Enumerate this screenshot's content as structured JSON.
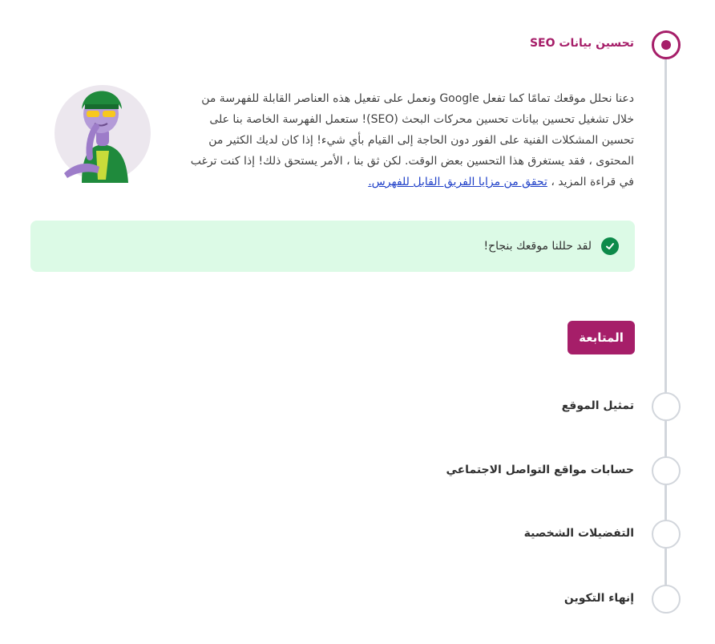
{
  "steps": [
    {
      "title": "تحسين بيانات SEO",
      "state": "active"
    },
    {
      "title": "تمثيل الموقع",
      "state": "pending"
    },
    {
      "title": "حسابات مواقع التواصل الاجتماعي",
      "state": "pending"
    },
    {
      "title": "التفضيلات الشخصية",
      "state": "pending"
    },
    {
      "title": "إنهاء التكوين",
      "state": "pending"
    }
  ],
  "seo": {
    "description": "دعنا نحلل موقعك تمامًا كما تفعل Google ونعمل على تفعيل هذه العناصر القابلة للفهرسة من خلال تشغيل تحسين بيانات تحسين محركات البحث (SEO)! ستعمل الفهرسة الخاصة بنا على تحسين المشكلات الفنية على الفور دون الحاجة إلى القيام بأي شيء! إذا كان لديك الكثير من المحتوى ، فقد يستغرق هذا التحسين بعض الوقت. لكن ثق بنا ، الأمر يستحق ذلك! إذا كنت ترغب في قراءة المزيد ،",
    "link_text": "تحقق من مزايا الفريق القابل للفهرس.",
    "success_message": "لقد حللنا موقعك بنجاح!",
    "continue_label": "المتابعة"
  },
  "colors": {
    "accent": "#a61e69",
    "success_bg": "#dcfae6",
    "success_icon": "#0d8a4a",
    "rail": "#d2d6dc"
  },
  "icons": {
    "success": "check-circle-icon",
    "illustration": "mascot-illustration"
  }
}
